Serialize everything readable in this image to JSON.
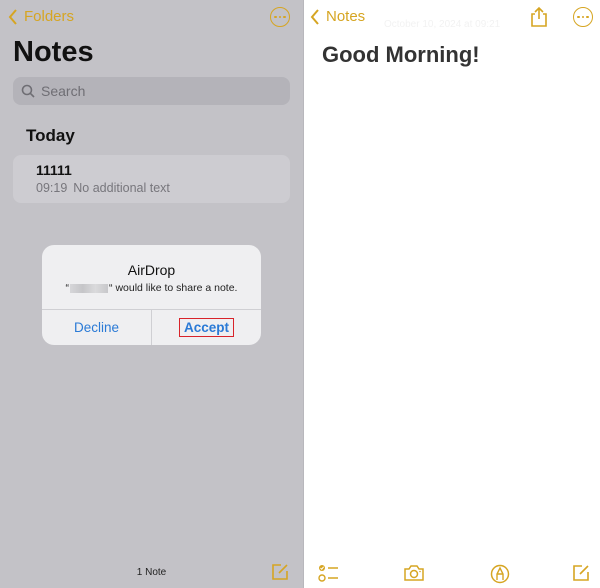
{
  "left": {
    "back_label": "Folders",
    "title": "Notes",
    "search_placeholder": "Search",
    "section_title": "Today",
    "notes": [
      {
        "title": "11111",
        "time": "09:19",
        "preview": "No additional text"
      }
    ],
    "note_count": "1 Note"
  },
  "alert": {
    "title": "AirDrop",
    "message_open_quote": "“",
    "message_close": "“ would like to share a note.",
    "decline_label": "Decline",
    "accept_label": "Accept"
  },
  "right": {
    "back_label": "Notes",
    "date": "October 10, 2024 at 09:21",
    "note_title": "Good Morning!"
  },
  "colors": {
    "accent": "#d6a522",
    "link_blue": "#2a7ad6",
    "highlight_red": "#d8232a"
  }
}
